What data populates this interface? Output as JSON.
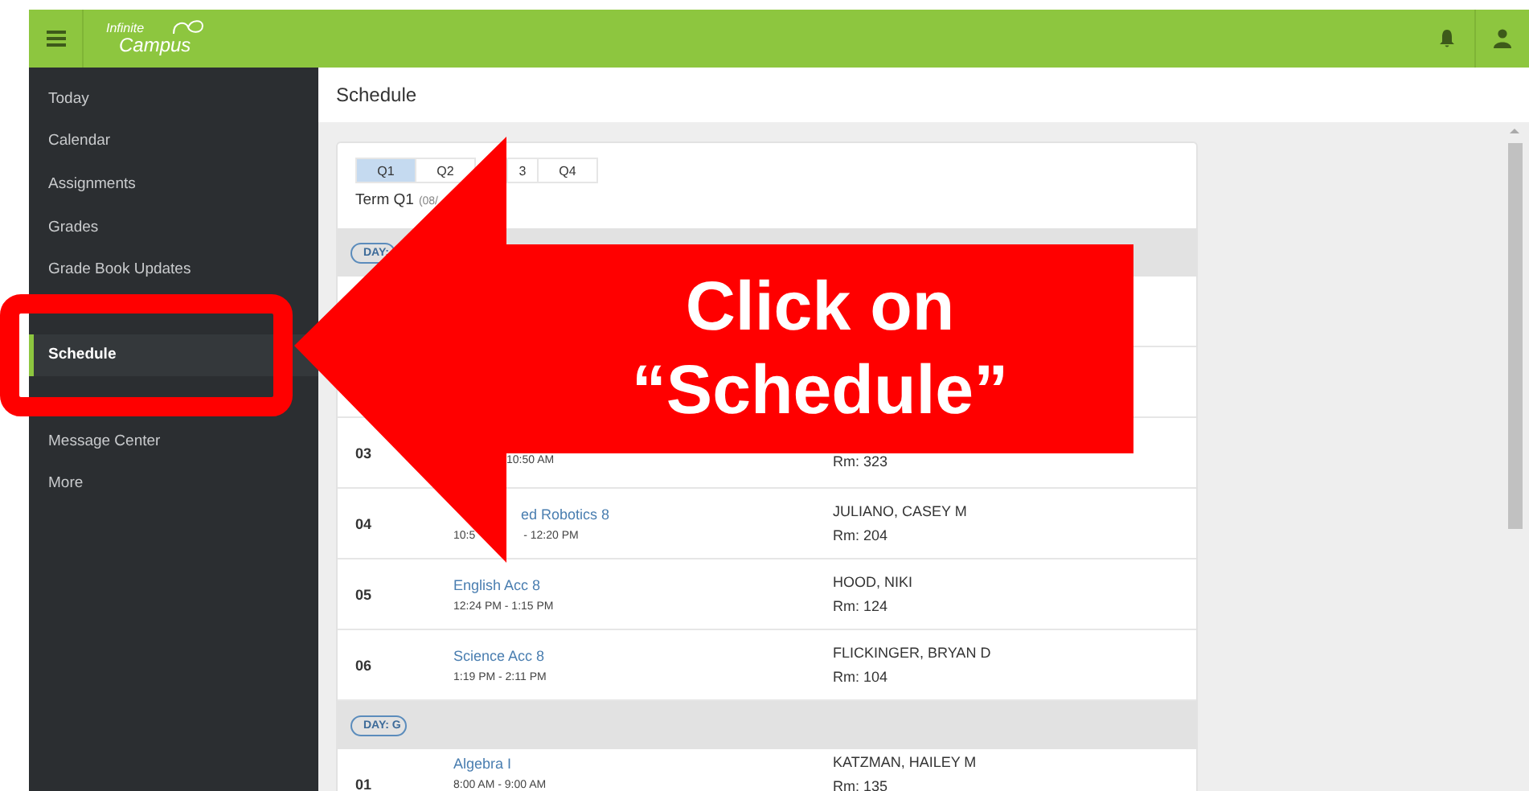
{
  "top_bar": {
    "logo_line_1": "Infinite",
    "logo_line_2": "Campus"
  },
  "sidebar": {
    "items": [
      {
        "label": "Today",
        "selected": false
      },
      {
        "label": "Calendar",
        "selected": false
      },
      {
        "label": "Assignments",
        "selected": false
      },
      {
        "label": "Grades",
        "selected": false
      },
      {
        "label": "Grade Book Updates",
        "selected": false
      },
      {
        "selected": false
      },
      {
        "label": "Schedule",
        "selected": true
      },
      {
        "selected": false
      },
      {
        "label": "Message Center",
        "selected": false
      },
      {
        "label": "More",
        "selected": false
      }
    ]
  },
  "page_title": "Schedule",
  "term_tabs": [
    {
      "label": "Q1",
      "selected": true
    },
    {
      "label": "Q2",
      "selected": false
    },
    {
      "label": "3",
      "selected": false
    },
    {
      "label": "Q4",
      "selected": false
    }
  ],
  "term": {
    "name": "Term Q1",
    "dates": "(08/"
  },
  "days": [
    {
      "badge": "DAY:",
      "rows": [
        {},
        {},
        {
          "period": "03",
          "time": "10:50 AM",
          "room": "Rm: 323"
        },
        {
          "period": "04",
          "course": "ed Robotics 8",
          "time_start": "10:5",
          "time": "- 12:20 PM",
          "teacher": "JULIANO, CASEY M",
          "room": "Rm: 204"
        },
        {
          "period": "05",
          "course": "English Acc 8",
          "time": "12:24 PM - 1:15 PM",
          "teacher": "HOOD, NIKI",
          "room": "Rm: 124"
        },
        {
          "period": "06",
          "course": "Science Acc 8",
          "time": "1:19 PM - 2:11 PM",
          "teacher": "FLICKINGER, BRYAN D",
          "room": "Rm: 104"
        }
      ]
    },
    {
      "badge": "DAY: G",
      "rows": [
        {
          "period": "01",
          "course": "Algebra I",
          "time": "8:00 AM - 9:00 AM",
          "teacher": "KATZMAN, HAILEY M",
          "room": "Rm: 135"
        }
      ]
    }
  ],
  "callout": {
    "line_1": "Click on",
    "line_2": "“Schedule”"
  }
}
